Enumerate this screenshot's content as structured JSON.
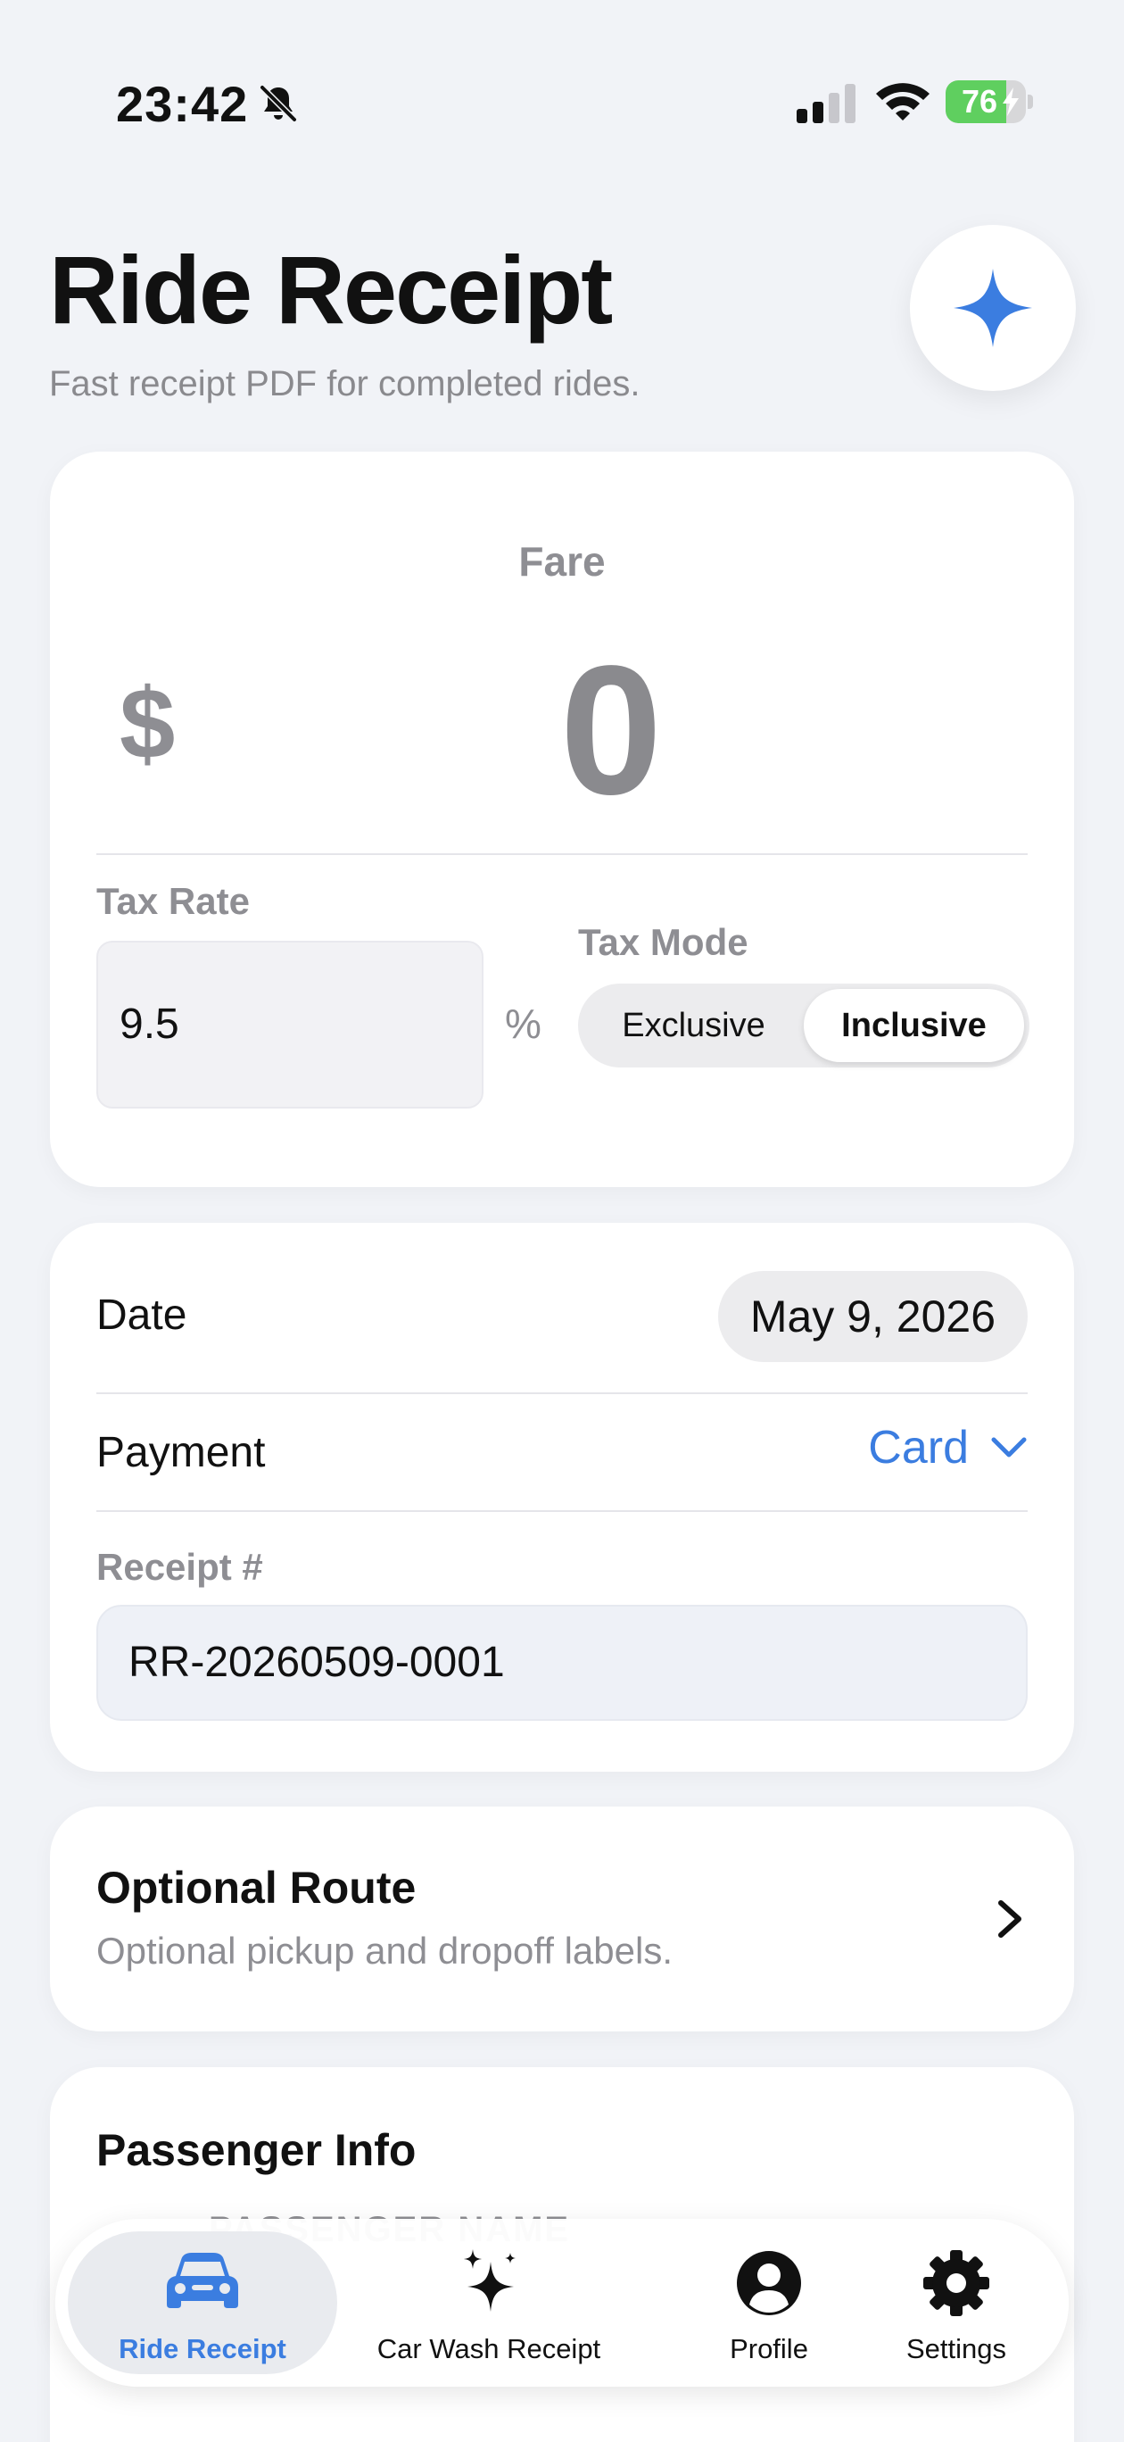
{
  "status_bar": {
    "time": "23:42",
    "battery": "76",
    "battery_level": 0.76
  },
  "header": {
    "title": "Ride Receipt",
    "subtitle": "Fast receipt PDF for completed rides."
  },
  "fare": {
    "label": "Fare",
    "currency": "$",
    "value": "0",
    "tax_rate_label": "Tax Rate",
    "tax_rate_value": "9.5",
    "percent_symbol": "%",
    "tax_mode_label": "Tax Mode",
    "tax_modes": [
      "Exclusive",
      "Inclusive"
    ],
    "tax_mode_selected": "Inclusive"
  },
  "details": {
    "date_label": "Date",
    "date_value": "May 9, 2026",
    "payment_label": "Payment",
    "payment_value": "Card",
    "receipt_label": "Receipt #",
    "receipt_value": "RR-20260509-0001"
  },
  "route": {
    "title": "Optional Route",
    "subtitle": "Optional pickup and dropoff labels."
  },
  "passenger": {
    "title": "Passenger Info",
    "name_label": "PASSENGER NAME"
  },
  "tabs": [
    {
      "label": "Ride Receipt",
      "icon": "car-icon",
      "active": true
    },
    {
      "label": "Car Wash Receipt",
      "icon": "sparkles-icon",
      "active": false
    },
    {
      "label": "Profile",
      "icon": "person-circle-icon",
      "active": false
    },
    {
      "label": "Settings",
      "icon": "gear-icon",
      "active": false
    }
  ],
  "colors": {
    "accent": "#3b7de0",
    "background": "#f1f3f7",
    "battery_green": "#5fcf5f"
  }
}
